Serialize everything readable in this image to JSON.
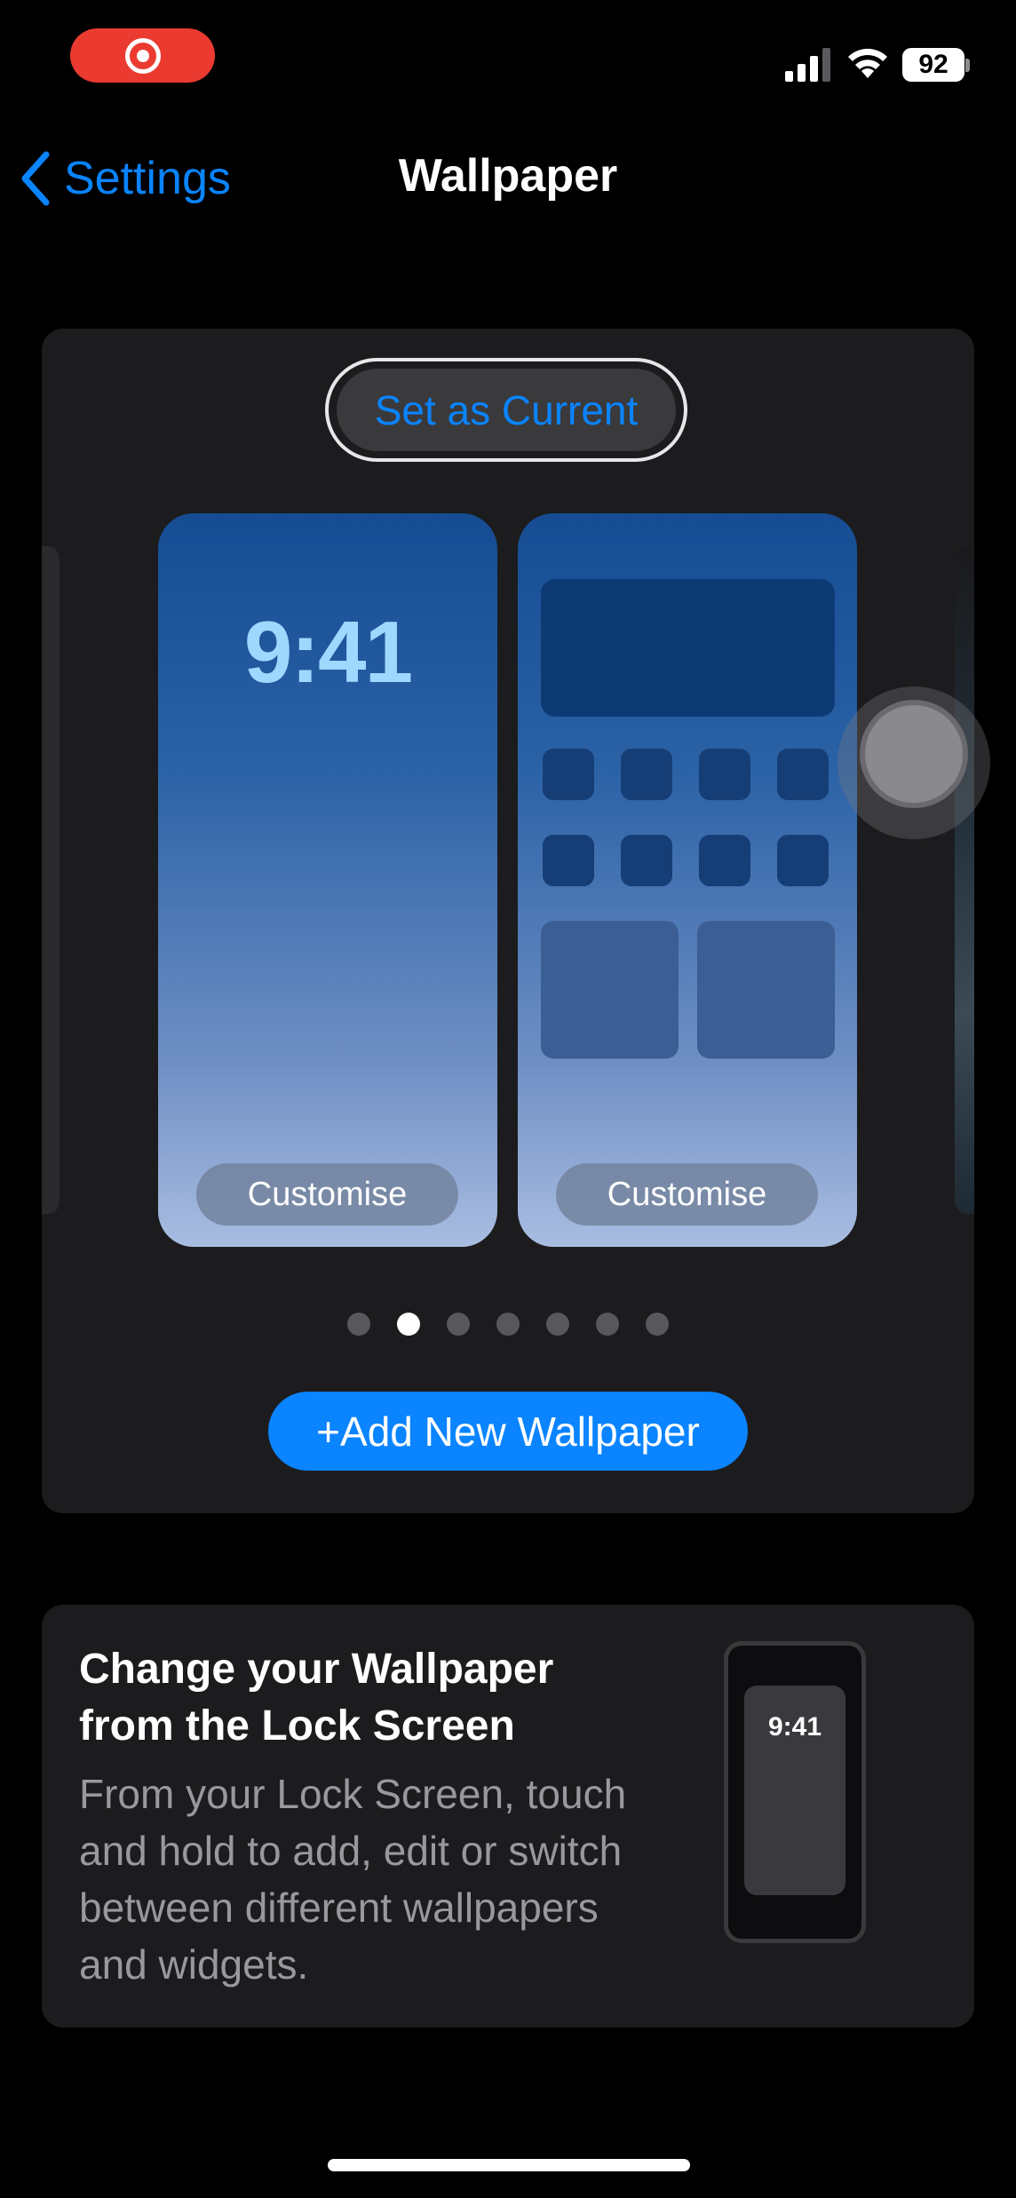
{
  "status_bar": {
    "battery": "92",
    "recording_icon": "screen-recording-icon",
    "signal_icon": "cellular-signal-icon",
    "wifi_icon": "wifi-icon"
  },
  "nav": {
    "back_label": "Settings",
    "title": "Wallpaper",
    "back_icon": "chevron-left-icon"
  },
  "wallpaper_card": {
    "set_current_label": "Set as Current",
    "lock_screen": {
      "time": "9:41",
      "customise_label": "Customise"
    },
    "home_screen": {
      "customise_label": "Customise"
    },
    "pager": {
      "count": 7,
      "active_index": 1
    },
    "add_button_label": "+Add New Wallpaper"
  },
  "info_card": {
    "title": "Change your Wallpaper from the Lock Screen",
    "body": "From your Lock Screen, touch and hold to add, edit or switch between different wallpapers and widgets.",
    "preview_time": "9:41"
  },
  "colors": {
    "accent": "#0a84ff",
    "record": "#eb3b30",
    "card": "#1c1c1e"
  }
}
